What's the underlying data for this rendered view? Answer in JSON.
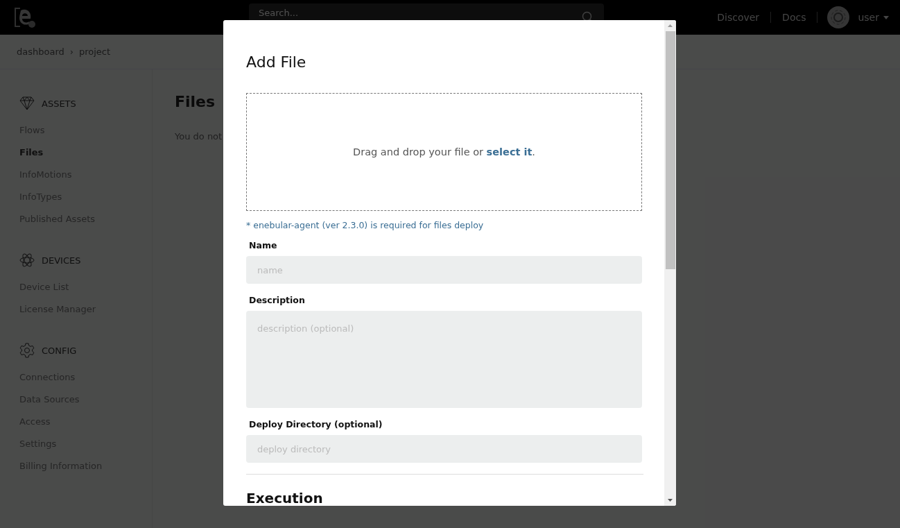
{
  "topbar": {
    "search": {
      "placeholder": "Search..."
    },
    "links": [
      "Discover",
      "Docs"
    ],
    "user": "user"
  },
  "breadcrumb": {
    "items": [
      "dashboard",
      "project"
    ],
    "separator": "›"
  },
  "sidebar": {
    "sections": [
      {
        "kind": "assets",
        "title": "ASSETS",
        "items": [
          {
            "label": "Flows",
            "selected": false
          },
          {
            "label": "Files",
            "selected": true
          },
          {
            "label": "InfoMotions",
            "selected": false
          },
          {
            "label": "InfoTypes",
            "selected": false
          },
          {
            "label": "Published Assets",
            "selected": false
          }
        ]
      },
      {
        "kind": "devices",
        "title": "DEVICES",
        "items": [
          {
            "label": "Device List",
            "selected": false
          },
          {
            "label": "License Manager",
            "selected": false
          }
        ]
      },
      {
        "kind": "config",
        "title": "CONFIG",
        "items": [
          {
            "label": "Connections",
            "selected": false
          },
          {
            "label": "Data Sources",
            "selected": false
          },
          {
            "label": "Access",
            "selected": false
          },
          {
            "label": "Settings",
            "selected": false
          },
          {
            "label": "Billing Information",
            "selected": false
          }
        ]
      }
    ]
  },
  "content": {
    "title": "Files",
    "text": "You do not"
  },
  "modal": {
    "title": "Add File",
    "dropzone": {
      "text": "Drag and drop your file or",
      "link": "select it",
      "end": "."
    },
    "note": "* enebular-agent (ver 2.3.0) is required for files deploy",
    "fields": [
      {
        "label": "Name",
        "kind": "input",
        "placeholder": "name"
      },
      {
        "label": "Description",
        "kind": "textarea",
        "placeholder": "description (optional)"
      },
      {
        "label": "Deploy Directory (optional)",
        "kind": "input",
        "placeholder": "deploy directory"
      }
    ],
    "section": "Execution"
  }
}
